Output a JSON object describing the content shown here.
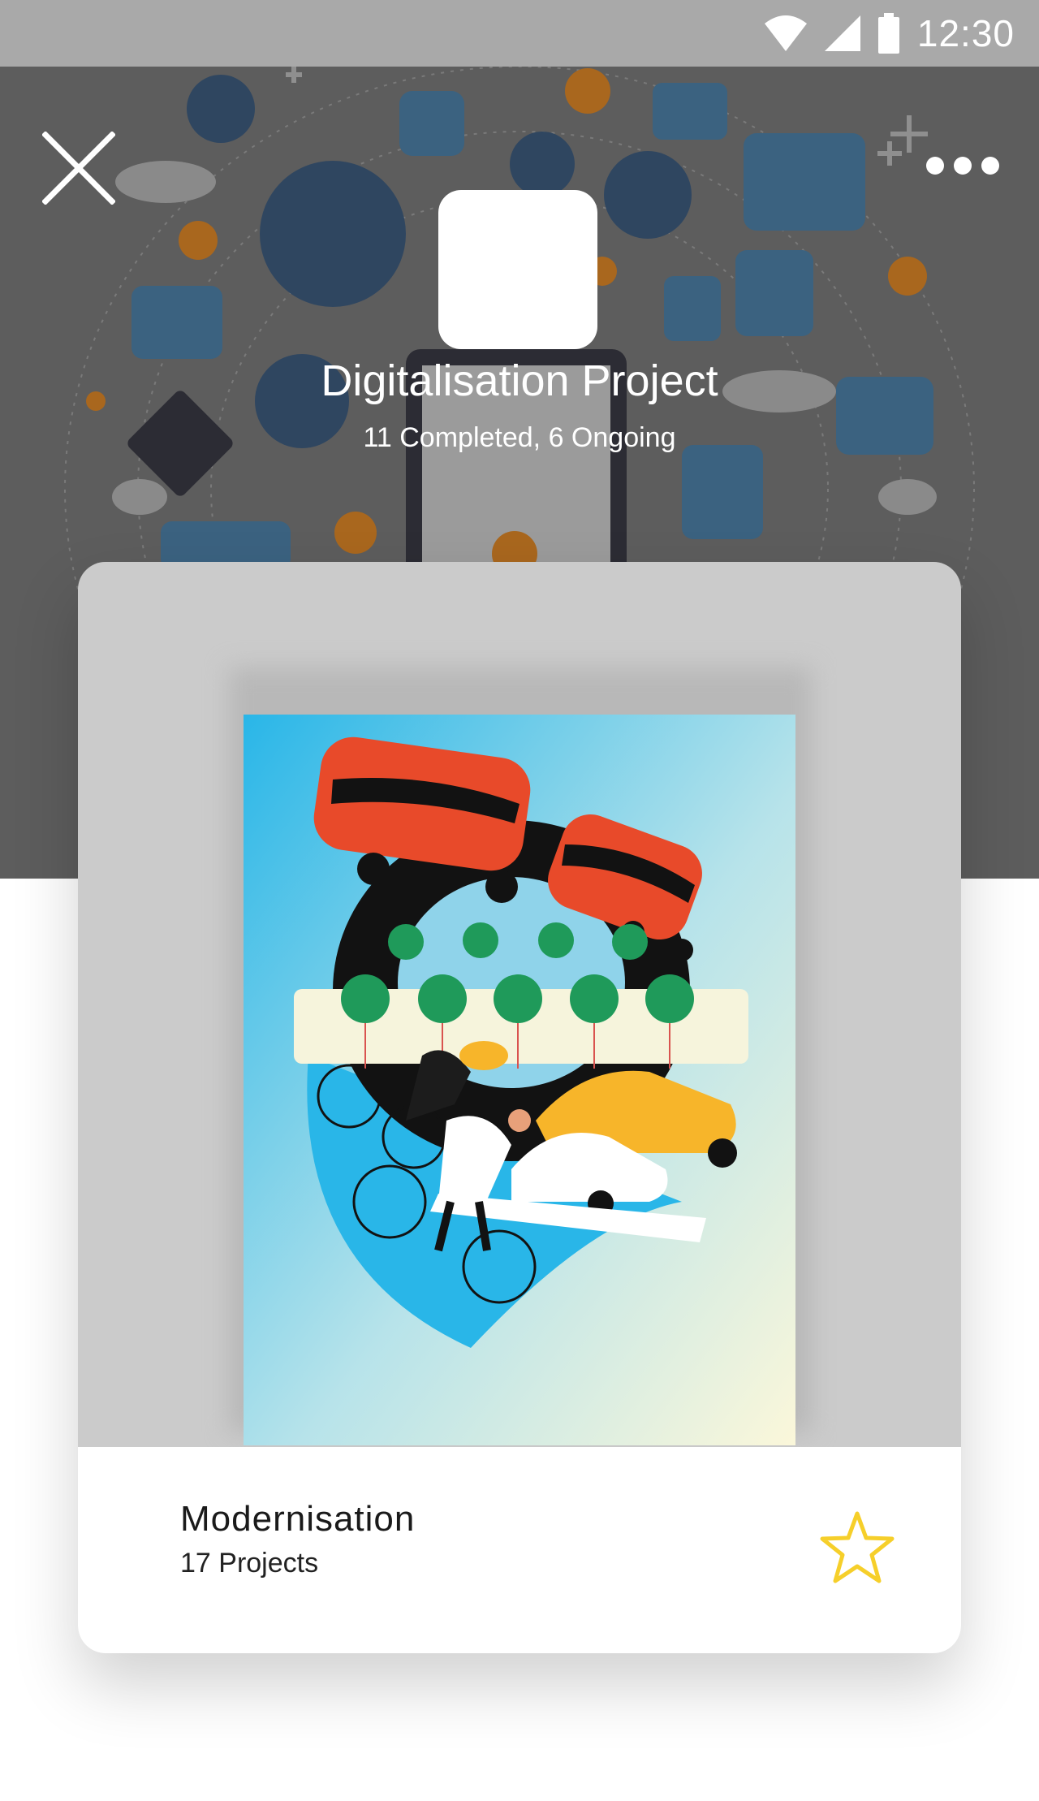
{
  "status_bar": {
    "time": "12:30",
    "icons": [
      "wifi-icon",
      "signal-icon",
      "battery-icon"
    ]
  },
  "header": {
    "close_icon": "close-icon",
    "more_icon": "more-icon",
    "title": "Digitalisation Project",
    "subtitle": "11 Completed, 6 Ongoing"
  },
  "card": {
    "title": "Modernisation",
    "count": "17 Projects",
    "favorite_icon": "star-outline-icon"
  },
  "colors": {
    "status_bar": "#a9a9a9",
    "hero_overlay": "#5d5d5d",
    "card_bg": "#cbcbcb",
    "star": "#f6cf2a",
    "bus": "#e84a2a",
    "taxi": "#f7b52a",
    "tree": "#1f9a5a",
    "sky": "#29b6e8"
  }
}
